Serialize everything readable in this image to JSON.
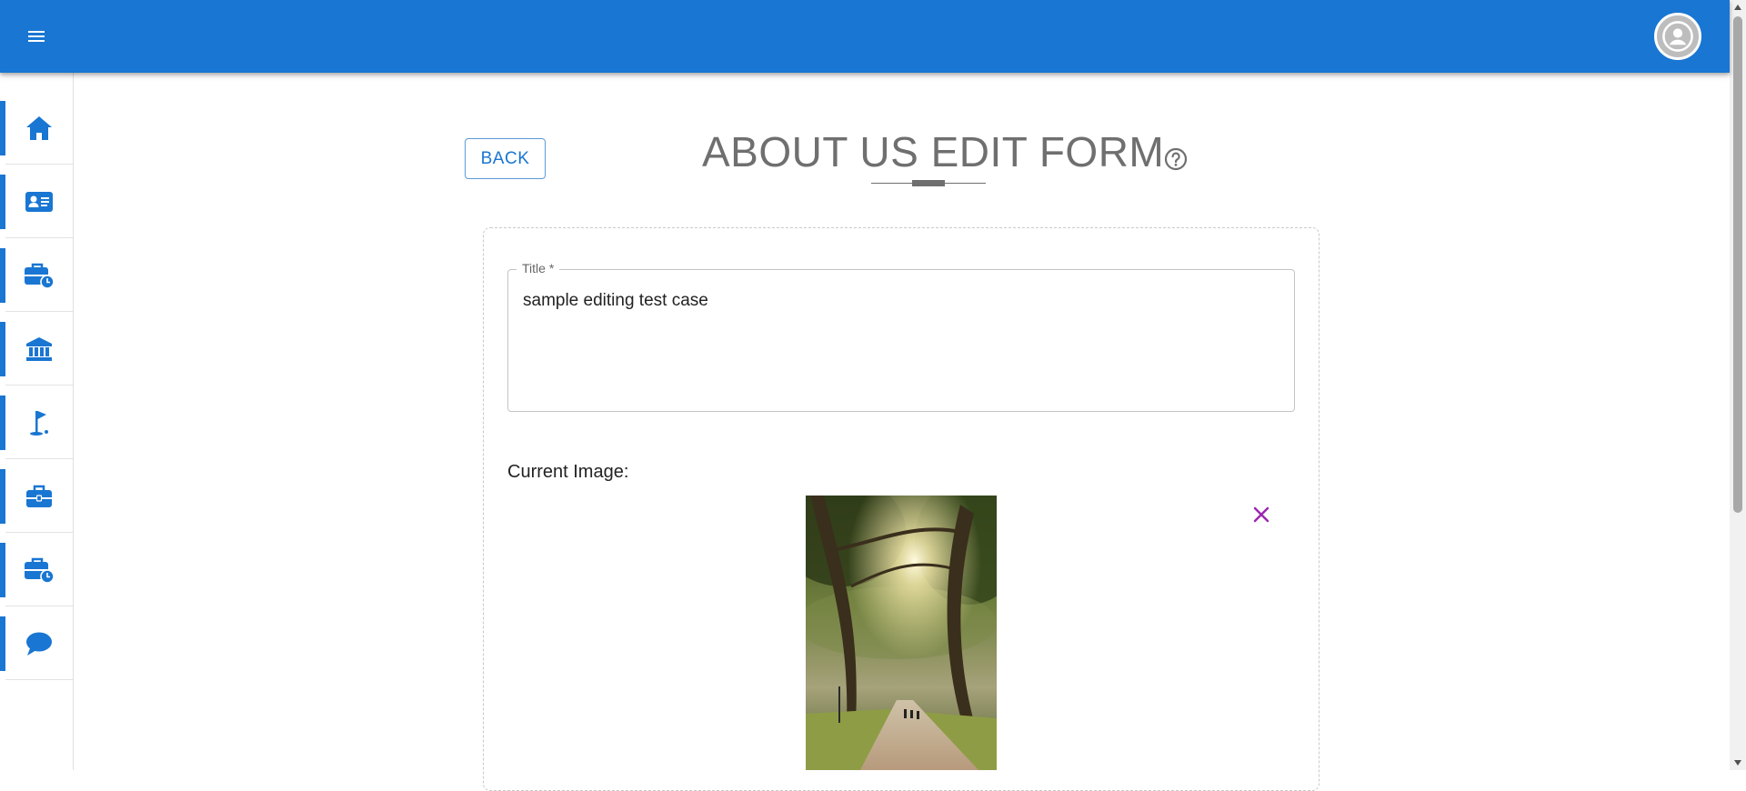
{
  "appbar": {
    "menu_icon": "hamburger-menu-icon",
    "avatar_icon": "person-icon",
    "color": "#1976d2"
  },
  "sidebar": {
    "items": [
      {
        "icon": "home-icon"
      },
      {
        "icon": "id-card-icon"
      },
      {
        "icon": "briefcase-clock-icon"
      },
      {
        "icon": "bank-icon"
      },
      {
        "icon": "golf-flag-icon"
      },
      {
        "icon": "briefcase-icon"
      },
      {
        "icon": "briefcase-clock-icon"
      },
      {
        "icon": "chat-bubble-icon"
      }
    ]
  },
  "header": {
    "back_label": "BACK",
    "title": "ABOUT US EDIT FORM",
    "help_icon": "help-circle-icon"
  },
  "form": {
    "title_label": "Title *",
    "title_value": "sample editing test case",
    "current_image_label": "Current Image:",
    "remove_icon": "close-icon",
    "remove_color": "#9c27b0"
  }
}
